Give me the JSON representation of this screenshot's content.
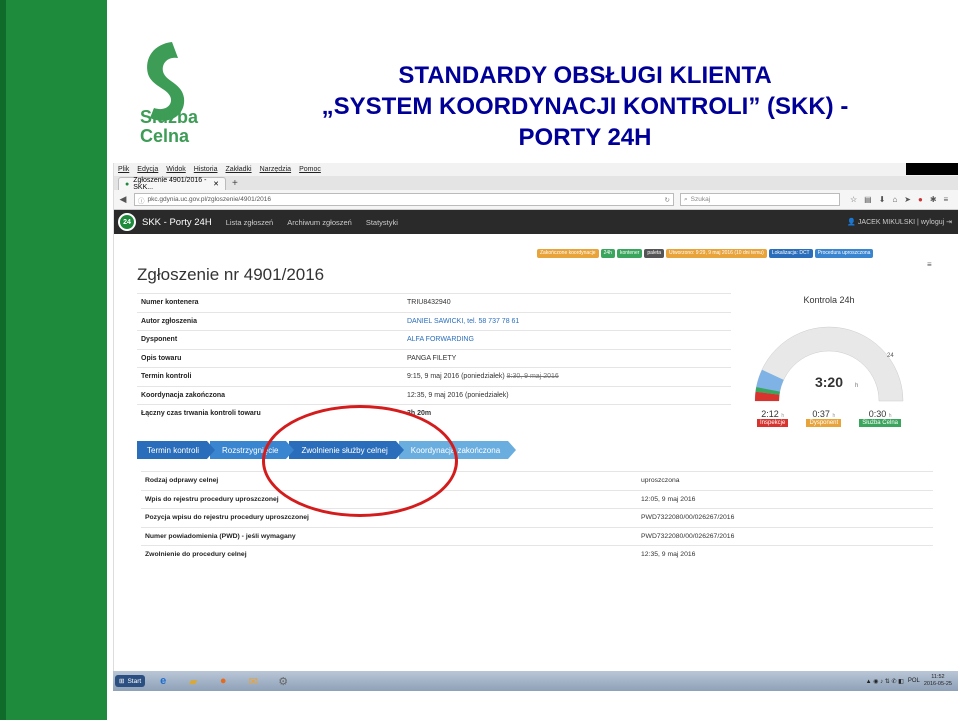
{
  "slide": {
    "logo_text_1": "Służba",
    "logo_text_2": "Celna",
    "title_line1": "STANDARDY OBSŁUGI KLIENTA",
    "title_line2": "„SYSTEM KOORDYNACJI KONTROLI” (SKK) -",
    "title_line3": "PORTY 24H"
  },
  "browser": {
    "menu": [
      "Plik",
      "Edycja",
      "Widok",
      "Historia",
      "Zakładki",
      "Narzędzia",
      "Pomoc"
    ],
    "tab_title": "Zgłoszenie 4901/2016 - SKK...",
    "new_tab": "+",
    "url": "pkc.gdynia.uc.gov.pl/zgloszenie/4901/2016",
    "search_placeholder": "Szukaj"
  },
  "app": {
    "logo_badge": "24",
    "brand": "SKK - Porty 24H",
    "nav": [
      "Lista zgłoszeń",
      "Archiwum zgłoszeń",
      "Statystyki"
    ],
    "user": "JACEK MIKULSKI | wyloguj"
  },
  "badges": [
    {
      "label": "Zakończone koordynacje",
      "color": "#e8a33a"
    },
    {
      "label": "24h",
      "color": "#3aa55c"
    },
    {
      "label": "kontener",
      "color": "#3aa55c"
    },
    {
      "label": "paleta",
      "color": "#555555"
    },
    {
      "label": "Utworzono: 9:29, 9 maj 2016 (10 dni temu)",
      "color": "#e8a33a"
    },
    {
      "label": "Lokalizacja: DCT",
      "color": "#2a6ebb"
    },
    {
      "label": "Procedura uproszczona",
      "color": "#3a85cf"
    }
  ],
  "page": {
    "title": "Zgłoszenie nr 4901/2016",
    "menu_icon": "≡"
  },
  "info": [
    {
      "key": "Numer kontenera",
      "value": "TRIU8432940"
    },
    {
      "key": "Autor zgłoszenia",
      "value": "DANIEL SAWICKI, tel. 58 737 78 61",
      "link": true
    },
    {
      "key": "Dysponent",
      "value": "ALFA FORWARDING",
      "link": true
    },
    {
      "key": "Opis towaru",
      "value": "PANGA FILETY"
    },
    {
      "key": "Termin kontroli",
      "value": "9:15, 9 maj 2016 (poniedziałek)",
      "strike": "8:30, 9 maj 2016"
    },
    {
      "key": "Koordynacja zakończona",
      "value": "12:35, 9 maj 2016 (poniedziałek)"
    },
    {
      "key": "Łączny czas trwania kontroli towaru",
      "value": "3h 20m"
    }
  ],
  "gauge": {
    "title": "Kontrola 24h",
    "value_text": "3:20",
    "unit": "h",
    "max_label": "24",
    "fraction": 0.139,
    "parts": [
      {
        "time": "2:12",
        "unit": "h",
        "label": "Inspekcje",
        "color": "#d9332e"
      },
      {
        "time": "0:37",
        "unit": "h",
        "label": "Dysponent",
        "color": "#e8a33a"
      },
      {
        "time": "0:30",
        "unit": "h",
        "label": "Służba Celna",
        "color": "#3aa55c"
      }
    ]
  },
  "steps": [
    "Termin kontroli",
    "Rozstrzygnięcie",
    "Zwolnienie służby celnej",
    "Koordynacja zakończona"
  ],
  "details": [
    {
      "key": "Rodzaj odprawy celnej",
      "value": "uproszczona"
    },
    {
      "key": "Wpis do rejestru procedury uproszczonej",
      "value": "12:05, 9 maj 2016"
    },
    {
      "key": "Pozycja wpisu do rejestru procedury uproszczonej",
      "value": "PWD7322080/00/026267/2016"
    },
    {
      "key": "Numer powiadomienia (PWD) - jeśli wymagany",
      "value": "PWD7322080/00/026267/2016"
    },
    {
      "key": "Zwolnienie do procedury celnej",
      "value": "12:35, 9 maj 2016"
    }
  ],
  "taskbar": {
    "start": "Start",
    "lang": "POL",
    "time": "11:52",
    "date": "2016-05-25"
  }
}
